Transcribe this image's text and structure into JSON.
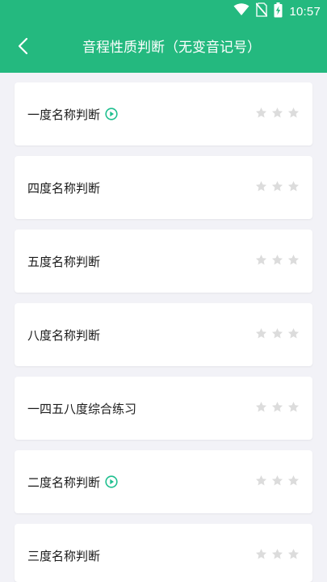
{
  "status_bar": {
    "time": "10:57",
    "icons": [
      "wifi-icon",
      "no-sim-icon",
      "battery-charging-icon"
    ]
  },
  "header": {
    "title": "音程性质判断（无变音记号）",
    "back_icon": "chevron-left-icon"
  },
  "colors": {
    "primary": "#24b97f",
    "accent_play": "#1fbf8f",
    "star_inactive": "#dcdcdc",
    "background": "#f2f2f7",
    "card": "#ffffff"
  },
  "items": [
    {
      "label": "一度名称判断",
      "has_video": true,
      "stars_filled": 0,
      "stars_total": 3
    },
    {
      "label": "四度名称判断",
      "has_video": false,
      "stars_filled": 0,
      "stars_total": 3
    },
    {
      "label": "五度名称判断",
      "has_video": false,
      "stars_filled": 0,
      "stars_total": 3
    },
    {
      "label": "八度名称判断",
      "has_video": false,
      "stars_filled": 0,
      "stars_total": 3
    },
    {
      "label": "一四五八度综合练习",
      "has_video": false,
      "stars_filled": 0,
      "stars_total": 3
    },
    {
      "label": "二度名称判断",
      "has_video": true,
      "stars_filled": 0,
      "stars_total": 3
    },
    {
      "label": "三度名称判断",
      "has_video": false,
      "stars_filled": 0,
      "stars_total": 3
    }
  ]
}
